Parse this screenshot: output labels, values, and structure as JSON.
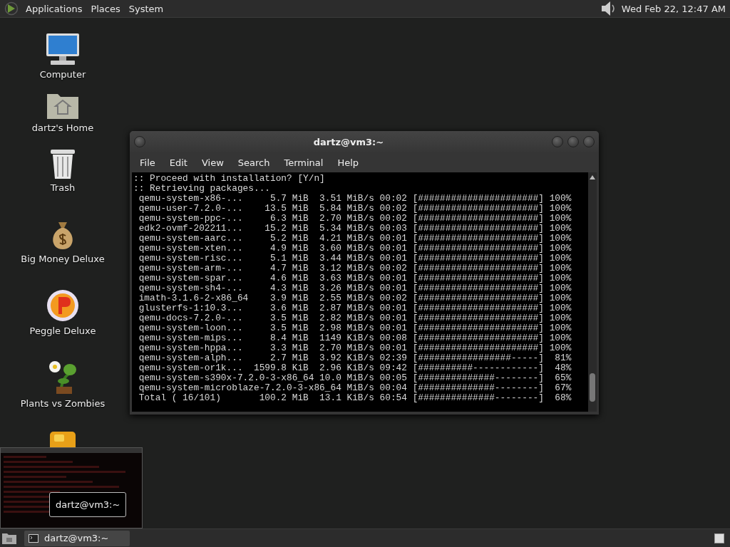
{
  "top_panel": {
    "menus": [
      "Applications",
      "Places",
      "System"
    ],
    "clock": "Wed Feb 22, 12:47 AM"
  },
  "desktop_icons": [
    {
      "kind": "computer",
      "label": "Computer"
    },
    {
      "kind": "home",
      "label": "dartz's Home"
    },
    {
      "kind": "trash",
      "label": "Trash"
    },
    {
      "kind": "moneybag",
      "label": "Big Money Deluxe"
    },
    {
      "kind": "peggle",
      "label": "Peggle Deluxe"
    },
    {
      "kind": "plants",
      "label": "Plants vs Zombies"
    },
    {
      "kind": "game"
    }
  ],
  "terminal": {
    "title": "dartz@vm3:~",
    "menu": [
      "File",
      "Edit",
      "View",
      "Search",
      "Terminal",
      "Help"
    ],
    "lines": [
      ":: Proceed with installation? [Y/n]",
      ":: Retrieving packages...",
      " qemu-system-x86-...     5.7 MiB  3.51 MiB/s 00:02 [######################] 100%",
      " qemu-user-7.2.0-...    13.5 MiB  5.84 MiB/s 00:02 [######################] 100%",
      " qemu-system-ppc-...     6.3 MiB  2.70 MiB/s 00:02 [######################] 100%",
      " edk2-ovmf-202211...    15.2 MiB  5.34 MiB/s 00:03 [######################] 100%",
      " qemu-system-aarc...     5.2 MiB  4.21 MiB/s 00:01 [######################] 100%",
      " qemu-system-xten...     4.9 MiB  3.60 MiB/s 00:01 [######################] 100%",
      " qemu-system-risc...     5.1 MiB  3.44 MiB/s 00:01 [######################] 100%",
      " qemu-system-arm-...     4.7 MiB  3.12 MiB/s 00:02 [######################] 100%",
      " qemu-system-spar...     4.6 MiB  3.63 MiB/s 00:01 [######################] 100%",
      " qemu-system-sh4-...     4.3 MiB  3.26 MiB/s 00:01 [######################] 100%",
      " imath-3.1.6-2-x86_64    3.9 MiB  2.55 MiB/s 00:02 [######################] 100%",
      " glusterfs-1:10.3...     3.6 MiB  2.87 MiB/s 00:01 [######################] 100%",
      " qemu-docs-7.2.0-...     3.5 MiB  2.82 MiB/s 00:01 [######################] 100%",
      " qemu-system-loon...     3.5 MiB  2.98 MiB/s 00:01 [######################] 100%",
      " qemu-system-mips...     8.4 MiB  1149 KiB/s 00:08 [######################] 100%",
      " qemu-system-hppa...     3.3 MiB  2.70 MiB/s 00:01 [######################] 100%",
      " qemu-system-alph...     2.7 MiB  3.92 KiB/s 02:39 [#################-----]  81%",
      " qemu-system-or1k...  1599.8 KiB  2.96 KiB/s 09:42 [##########------------]  48%",
      " qemu-system-s390x-7.2.0-3-x86_64 10.0 MiB/s 00:05 [##############--------]  65%",
      " qemu-system-microblaze-7.2.0-3-x86_64 MiB/s 00:04 [##############--------]  67%",
      " Total ( 16/101)       100.2 MiB  13.1 KiB/s 60:54 [##############--------]  68%"
    ]
  },
  "preview": {
    "label": "dartz@vm3:~"
  },
  "taskbar": {
    "items": [
      {
        "label": "dartz@vm3:~"
      }
    ]
  }
}
